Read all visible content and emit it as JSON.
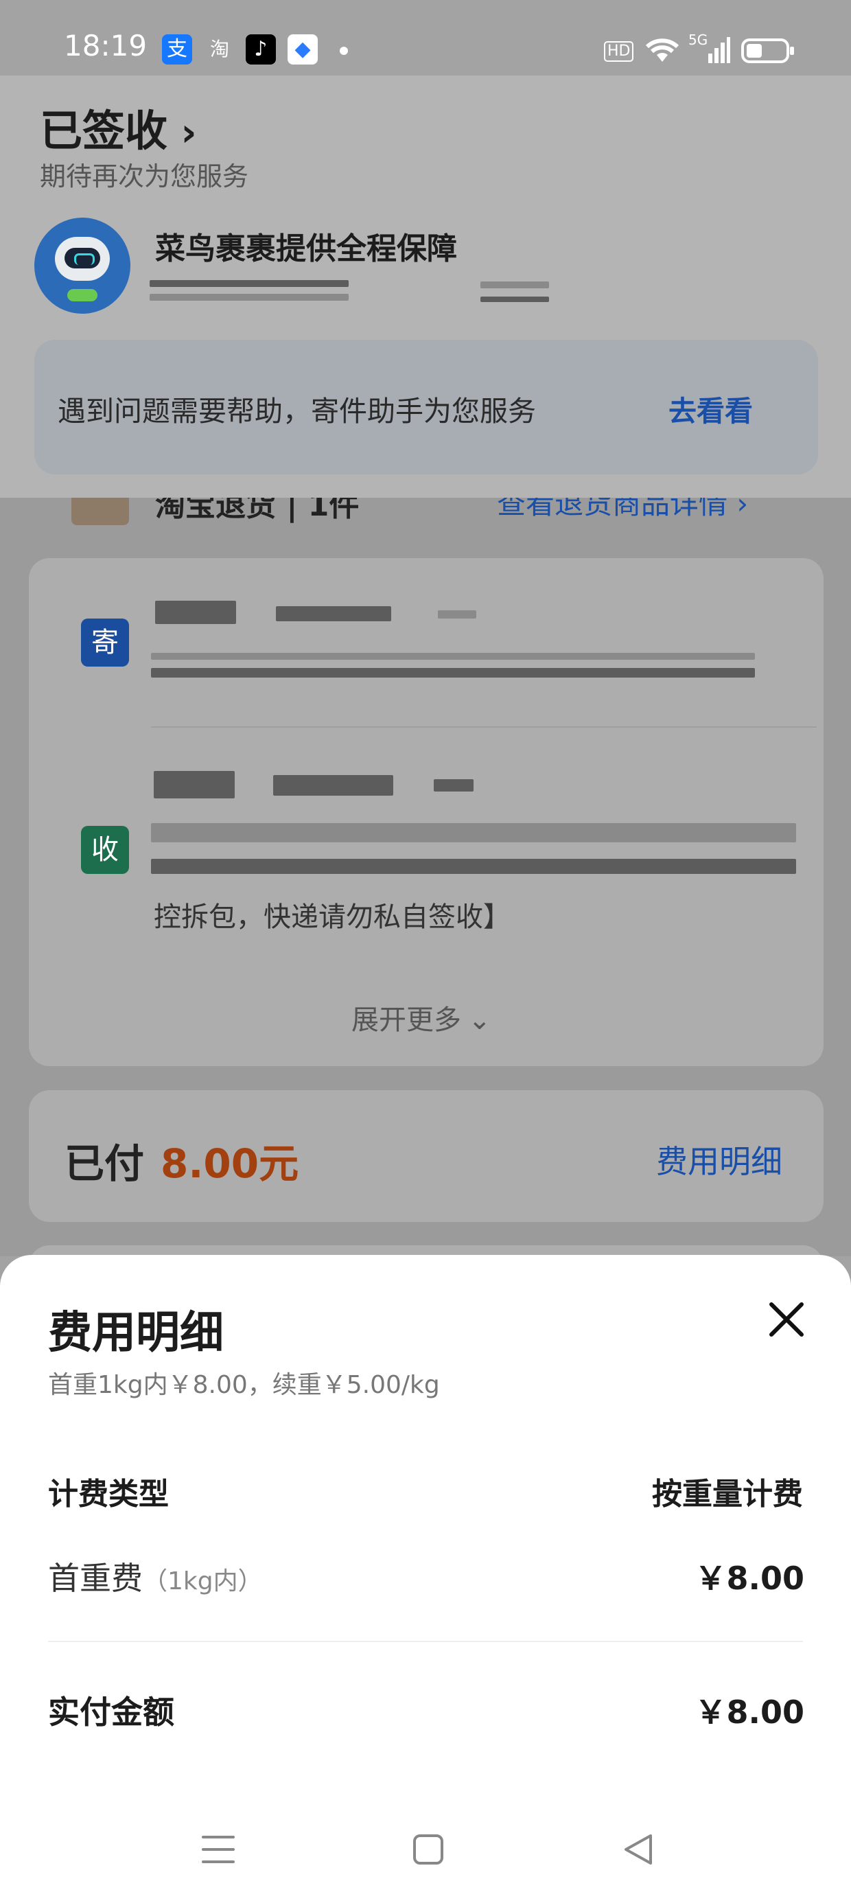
{
  "status_bar": {
    "time": "18:19",
    "apps": [
      {
        "icon": "alipay-icon",
        "glyph": "支",
        "color": "#1677ff"
      },
      {
        "icon": "taobao-icon",
        "glyph": "淘",
        "color": "#ff5000"
      },
      {
        "icon": "tiktok-icon",
        "glyph": "♪",
        "color": "#000000"
      },
      {
        "icon": "app-icon",
        "glyph": "◆",
        "color": "#2a7cff"
      }
    ],
    "hd": "HD",
    "network": "5G"
  },
  "header": {
    "title": "已签收",
    "subtitle": "期待再次为您服务"
  },
  "guarantee": {
    "text": "菜鸟裹裹提供全程保障"
  },
  "help_banner": {
    "text": "遇到问题需要帮助，寄件助手为您服务",
    "link": "去看看"
  },
  "order": {
    "title": "淘宝退货 | 1件",
    "link": "查看退货商品详情 ›"
  },
  "address": {
    "sender_badge": "寄",
    "receiver_badge": "收",
    "note": "控拆包，快递请勿私自签收】",
    "expand": "展开更多"
  },
  "payment": {
    "label": "已付",
    "amount": "8.00元",
    "link": "费用明细"
  },
  "fee_sheet": {
    "title": "费用明细",
    "subtitle": "首重1kg内￥8.00，续重￥5.00/kg",
    "billing_type_label": "计费类型",
    "billing_type_value": "按重量计费",
    "first_weight_label": "首重费",
    "first_weight_note": "（1kg内）",
    "first_weight_value": "￥8.00",
    "total_label": "实付金额",
    "total_value": "￥8.00"
  },
  "colors": {
    "accent_blue": "#1a57b8",
    "amount_orange": "#a3400f",
    "sender_blue": "#1b55b5",
    "receiver_green": "#1d8a5c"
  }
}
